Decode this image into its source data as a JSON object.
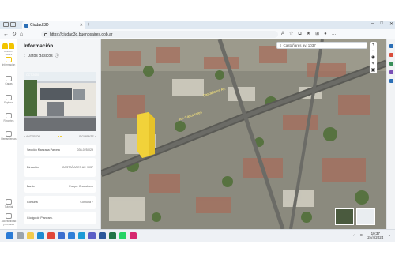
{
  "browser": {
    "tab_title": "Ciudad 3D",
    "new_tab": "+",
    "url": "https://ciudad3d.buenosaires.gob.ar",
    "window_controls": [
      "–",
      "□",
      "✕"
    ]
  },
  "rail": {
    "logo_sub": "BUENOS AIRES",
    "items": [
      {
        "label": "Información",
        "icon": "info-icon"
      },
      {
        "label": "Capas",
        "icon": "layers-icon"
      },
      {
        "label": "Explorar",
        "icon": "explore-icon"
      },
      {
        "label": "Reportes",
        "icon": "report-icon"
      },
      {
        "label": "Herramientas",
        "icon": "tools-icon"
      },
      {
        "label": "Tutorial",
        "icon": "tutorial-icon"
      },
      {
        "label": "Accesibilidad y mejoras",
        "icon": "accessibility-icon"
      }
    ]
  },
  "panel": {
    "title": "Información",
    "back_label": "Datos Básicos",
    "photo_date": "OCT 2020",
    "photo_nav": {
      "prev": "ANTERIOR",
      "next": "SIGUIENTE"
    },
    "rows": [
      {
        "label": "Sección Manzana Parcela",
        "value": "036-025-029"
      },
      {
        "label": "Dirección",
        "value": "CASTAÑARES AV. 1037"
      },
      {
        "label": "Barrio",
        "value": "Parque Chacabuco"
      },
      {
        "label": "Comuna",
        "value": "Comuna 7"
      },
      {
        "label": "Código de Planeam.",
        "value": ""
      }
    ]
  },
  "map": {
    "search_value": "Castañares av. 1037",
    "street_labels": [
      "Castañares Av.",
      "Av. Castañares"
    ]
  },
  "taskbar": {
    "time": "10:37",
    "date": "24/4/2024",
    "icons": [
      "start-icon",
      "search-icon",
      "file-explorer-icon",
      "edge-icon",
      "chrome-icon",
      "store-icon",
      "mail-icon",
      "photos-icon",
      "teams-icon",
      "word-icon",
      "excel-icon",
      "whatsapp-icon",
      "instagram-icon"
    ]
  }
}
